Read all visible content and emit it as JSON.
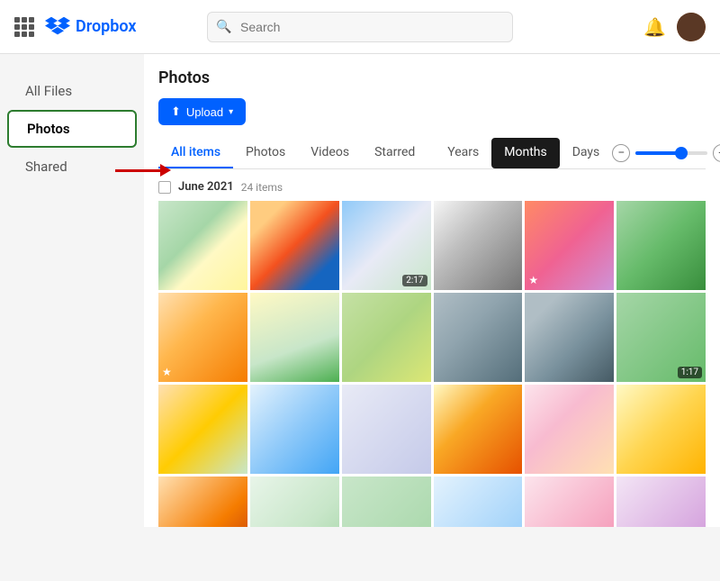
{
  "app": {
    "name": "Dropbox"
  },
  "nav": {
    "search_placeholder": "Search",
    "bell_label": "Notifications",
    "avatar_label": "User avatar"
  },
  "sidebar": {
    "items": [
      {
        "id": "all-files",
        "label": "All Files",
        "active": false
      },
      {
        "id": "photos",
        "label": "Photos",
        "active": true
      },
      {
        "id": "shared",
        "label": "Shared",
        "active": false
      }
    ]
  },
  "main": {
    "page_title": "Photos",
    "upload_button": "Upload",
    "tabs": [
      {
        "id": "all-items",
        "label": "All items",
        "active": true
      },
      {
        "id": "photos",
        "label": "Photos",
        "active": false
      },
      {
        "id": "videos",
        "label": "Videos",
        "active": false
      },
      {
        "id": "starred",
        "label": "Starred",
        "active": false
      },
      {
        "id": "years",
        "label": "Years",
        "active": false
      },
      {
        "id": "months",
        "label": "Months",
        "active": true,
        "highlighted": true
      },
      {
        "id": "days",
        "label": "Days",
        "active": false
      }
    ],
    "zoom_minus": "−",
    "zoom_plus": "+",
    "section": {
      "title": "June 2021",
      "count": "24 items"
    }
  }
}
